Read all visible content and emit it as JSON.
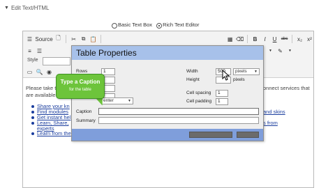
{
  "header": {
    "title": "Edit Text/HTML"
  },
  "mode": {
    "basic_label": "Basic Text Box",
    "rich_label": "Rich Text Editor",
    "selected": "rich"
  },
  "toolbar": {
    "source_label": "Source",
    "bold": "B",
    "italic": "I",
    "underline": "U",
    "strike": "abc",
    "subscript": "x₂",
    "superscript": "x²",
    "style_label": "Style"
  },
  "content": {
    "para_start": "Please take th",
    "para_end": "onnect services that",
    "para2_start": "are available t",
    "links": [
      {
        "start": "Share your kn",
        "end": ""
      },
      {
        "start": "Find modules",
        "end": "and skins"
      },
      {
        "start": "Get instant hel",
        "end": ""
      },
      {
        "start": "Learn, Share, ",
        "end": "s from"
      },
      {
        "start": "experts",
        "end": ""
      },
      {
        "start": "Learn from the",
        "end": ""
      }
    ]
  },
  "dialog": {
    "title": "Table Properties",
    "rows_label": "Rows",
    "rows_value": "1",
    "alignment_value": "enter",
    "width_label": "Width",
    "width_value": "500",
    "width_unit": "pixels",
    "height_label": "Height",
    "height_unit": "pixels",
    "cell_spacing_label": "Cell spacing",
    "cell_spacing_value": "1",
    "cell_padding_label": "Cell padding",
    "cell_padding_value": "1",
    "caption_label": "Caption",
    "summary_label": "Summary"
  },
  "callout": {
    "line1": "Type a Caption",
    "line2": "for the table"
  }
}
